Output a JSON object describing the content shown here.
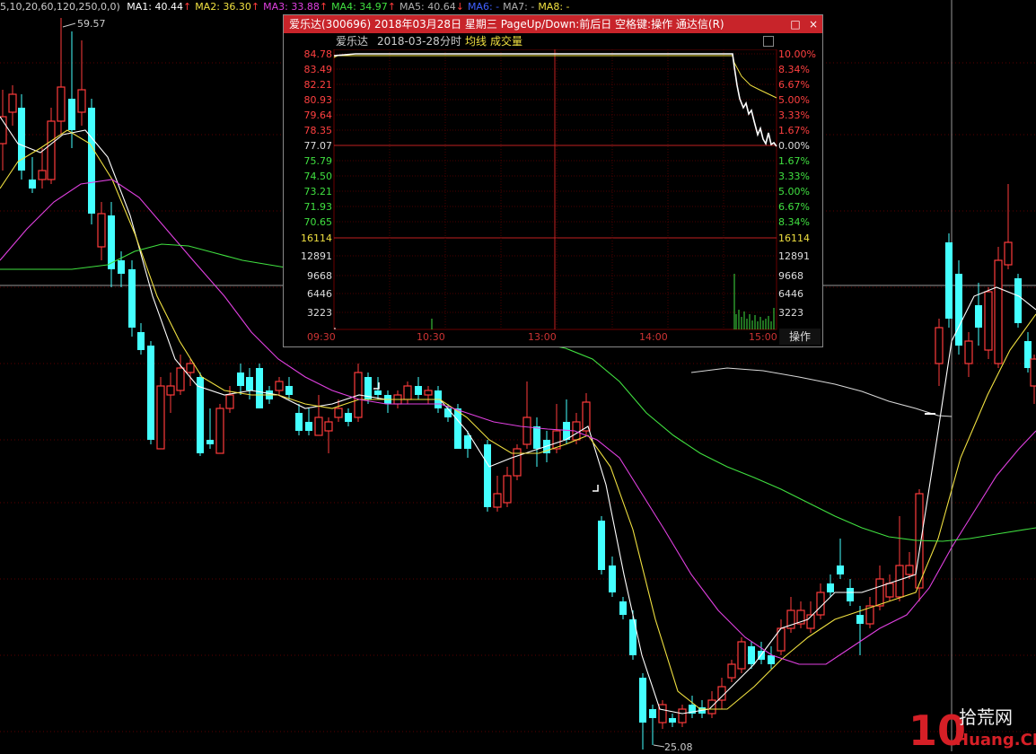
{
  "ma_header": {
    "params": "5,10,20,60,120,250,0,0)",
    "items": [
      {
        "label": "MA1: 40.44",
        "arrow": "↑",
        "color": "#ffffff"
      },
      {
        "label": "MA2: 36.30",
        "arrow": "↑",
        "color": "#f0e040"
      },
      {
        "label": "MA3: 33.88",
        "arrow": "↑",
        "color": "#e040e0"
      },
      {
        "label": "MA4: 34.97",
        "arrow": "↑",
        "color": "#40e040"
      },
      {
        "label": "MA5: 40.64",
        "arrow": "↓",
        "color": "#b0b0b0"
      },
      {
        "label": "MA6: -",
        "arrow": "",
        "color": "#4060ff"
      },
      {
        "label": "MA7: -",
        "arrow": "",
        "color": "#b0b0b0"
      },
      {
        "label": "MA8: -",
        "arrow": "",
        "color": "#f0e040"
      }
    ]
  },
  "main_chart": {
    "high_label": "59.57",
    "low_label": "25.08",
    "colors": {
      "up": "#ff3b3b",
      "down": "#44ffff",
      "ma1": "#ffffff",
      "ma2": "#f0e040",
      "ma3": "#e040e0",
      "ma4": "#40e040",
      "ma5": "#d8d8d8"
    }
  },
  "popup": {
    "title": "爱乐达(300696) 2018年03月28日 星期三 PageUp/Down:前后日 空格键:操作 通达信(R)",
    "close_label": "×",
    "maximize_label": "□",
    "stock_name": "爱乐达",
    "date": "2018-03-28",
    "tab_minute": "分时",
    "tab_avg": "均线",
    "tab_volume": "成交量",
    "price_labels": [
      "84.78",
      "83.49",
      "82.21",
      "80.93",
      "79.64",
      "78.35",
      "77.07",
      "75.79",
      "74.50",
      "73.21",
      "71.93",
      "70.65"
    ],
    "pct_labels": [
      "10.00%",
      "8.34%",
      "6.67%",
      "5.00%",
      "3.33%",
      "1.67%",
      "0.00%",
      "1.67%",
      "3.33%",
      "5.00%",
      "6.67%",
      "8.34%"
    ],
    "vol_labels": [
      "16114",
      "12891",
      "9668",
      "6446",
      "3223"
    ],
    "time_labels": [
      "09:30",
      "10:30",
      "13:00",
      "14:00",
      "15:00"
    ],
    "operate_label": "操作"
  },
  "watermark": {
    "number": "10",
    "cn": "拾荒网",
    "en": "Huang.CN"
  }
}
